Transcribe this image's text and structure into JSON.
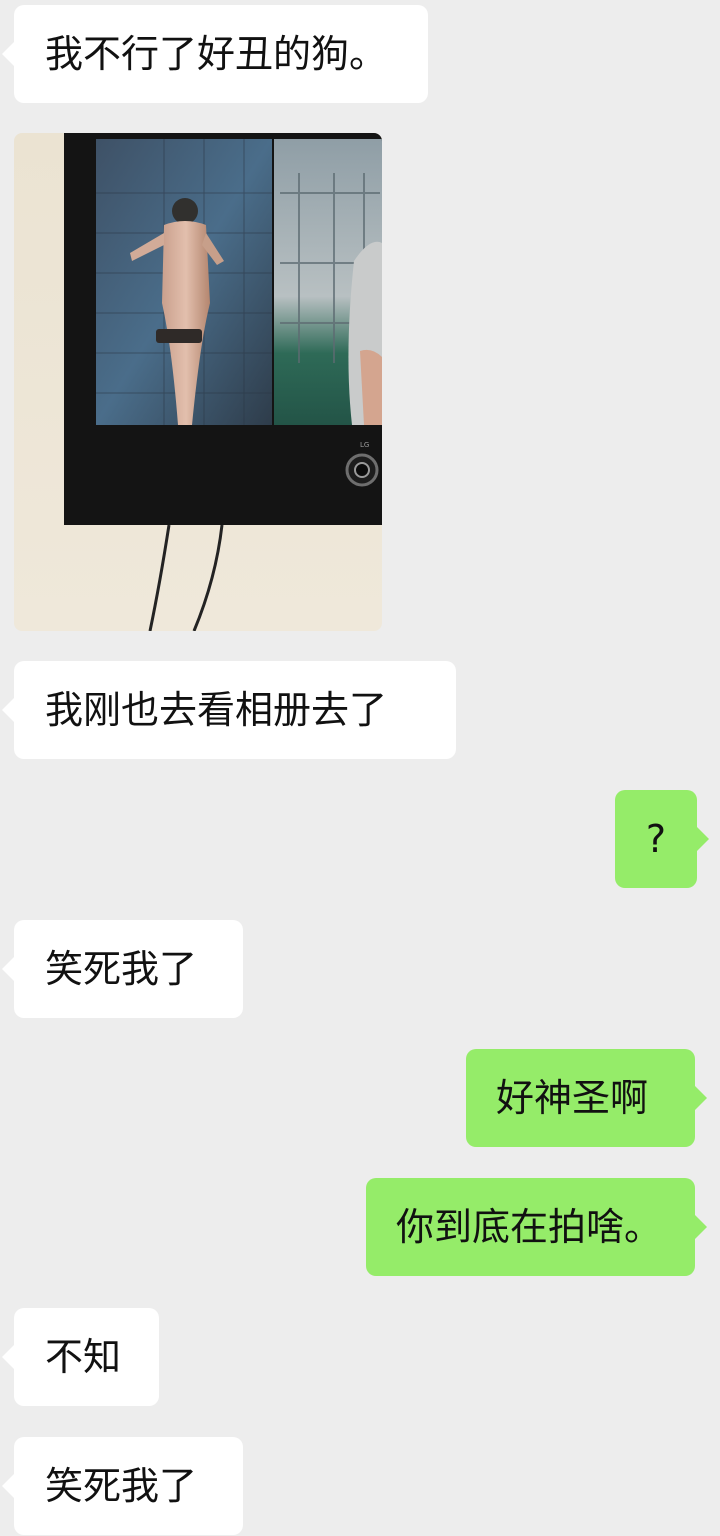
{
  "messages": [
    {
      "side": "in",
      "text": "我不行了好丑的狗。"
    },
    {
      "side": "in",
      "type": "image",
      "subject": "photo-of-tv-screen"
    },
    {
      "side": "in",
      "text": "我刚也去看相册去了"
    },
    {
      "side": "out",
      "text": "?"
    },
    {
      "side": "in",
      "text": "笑死我了"
    },
    {
      "side": "out",
      "text": "好神圣啊"
    },
    {
      "side": "out",
      "text": "你到底在拍啥。"
    },
    {
      "side": "in",
      "text": "不知"
    },
    {
      "side": "in",
      "text": "笑死我了"
    }
  ],
  "colors": {
    "background": "#ededed",
    "incoming_bubble": "#ffffff",
    "outgoing_bubble": "#95ec69",
    "text": "#111111"
  }
}
